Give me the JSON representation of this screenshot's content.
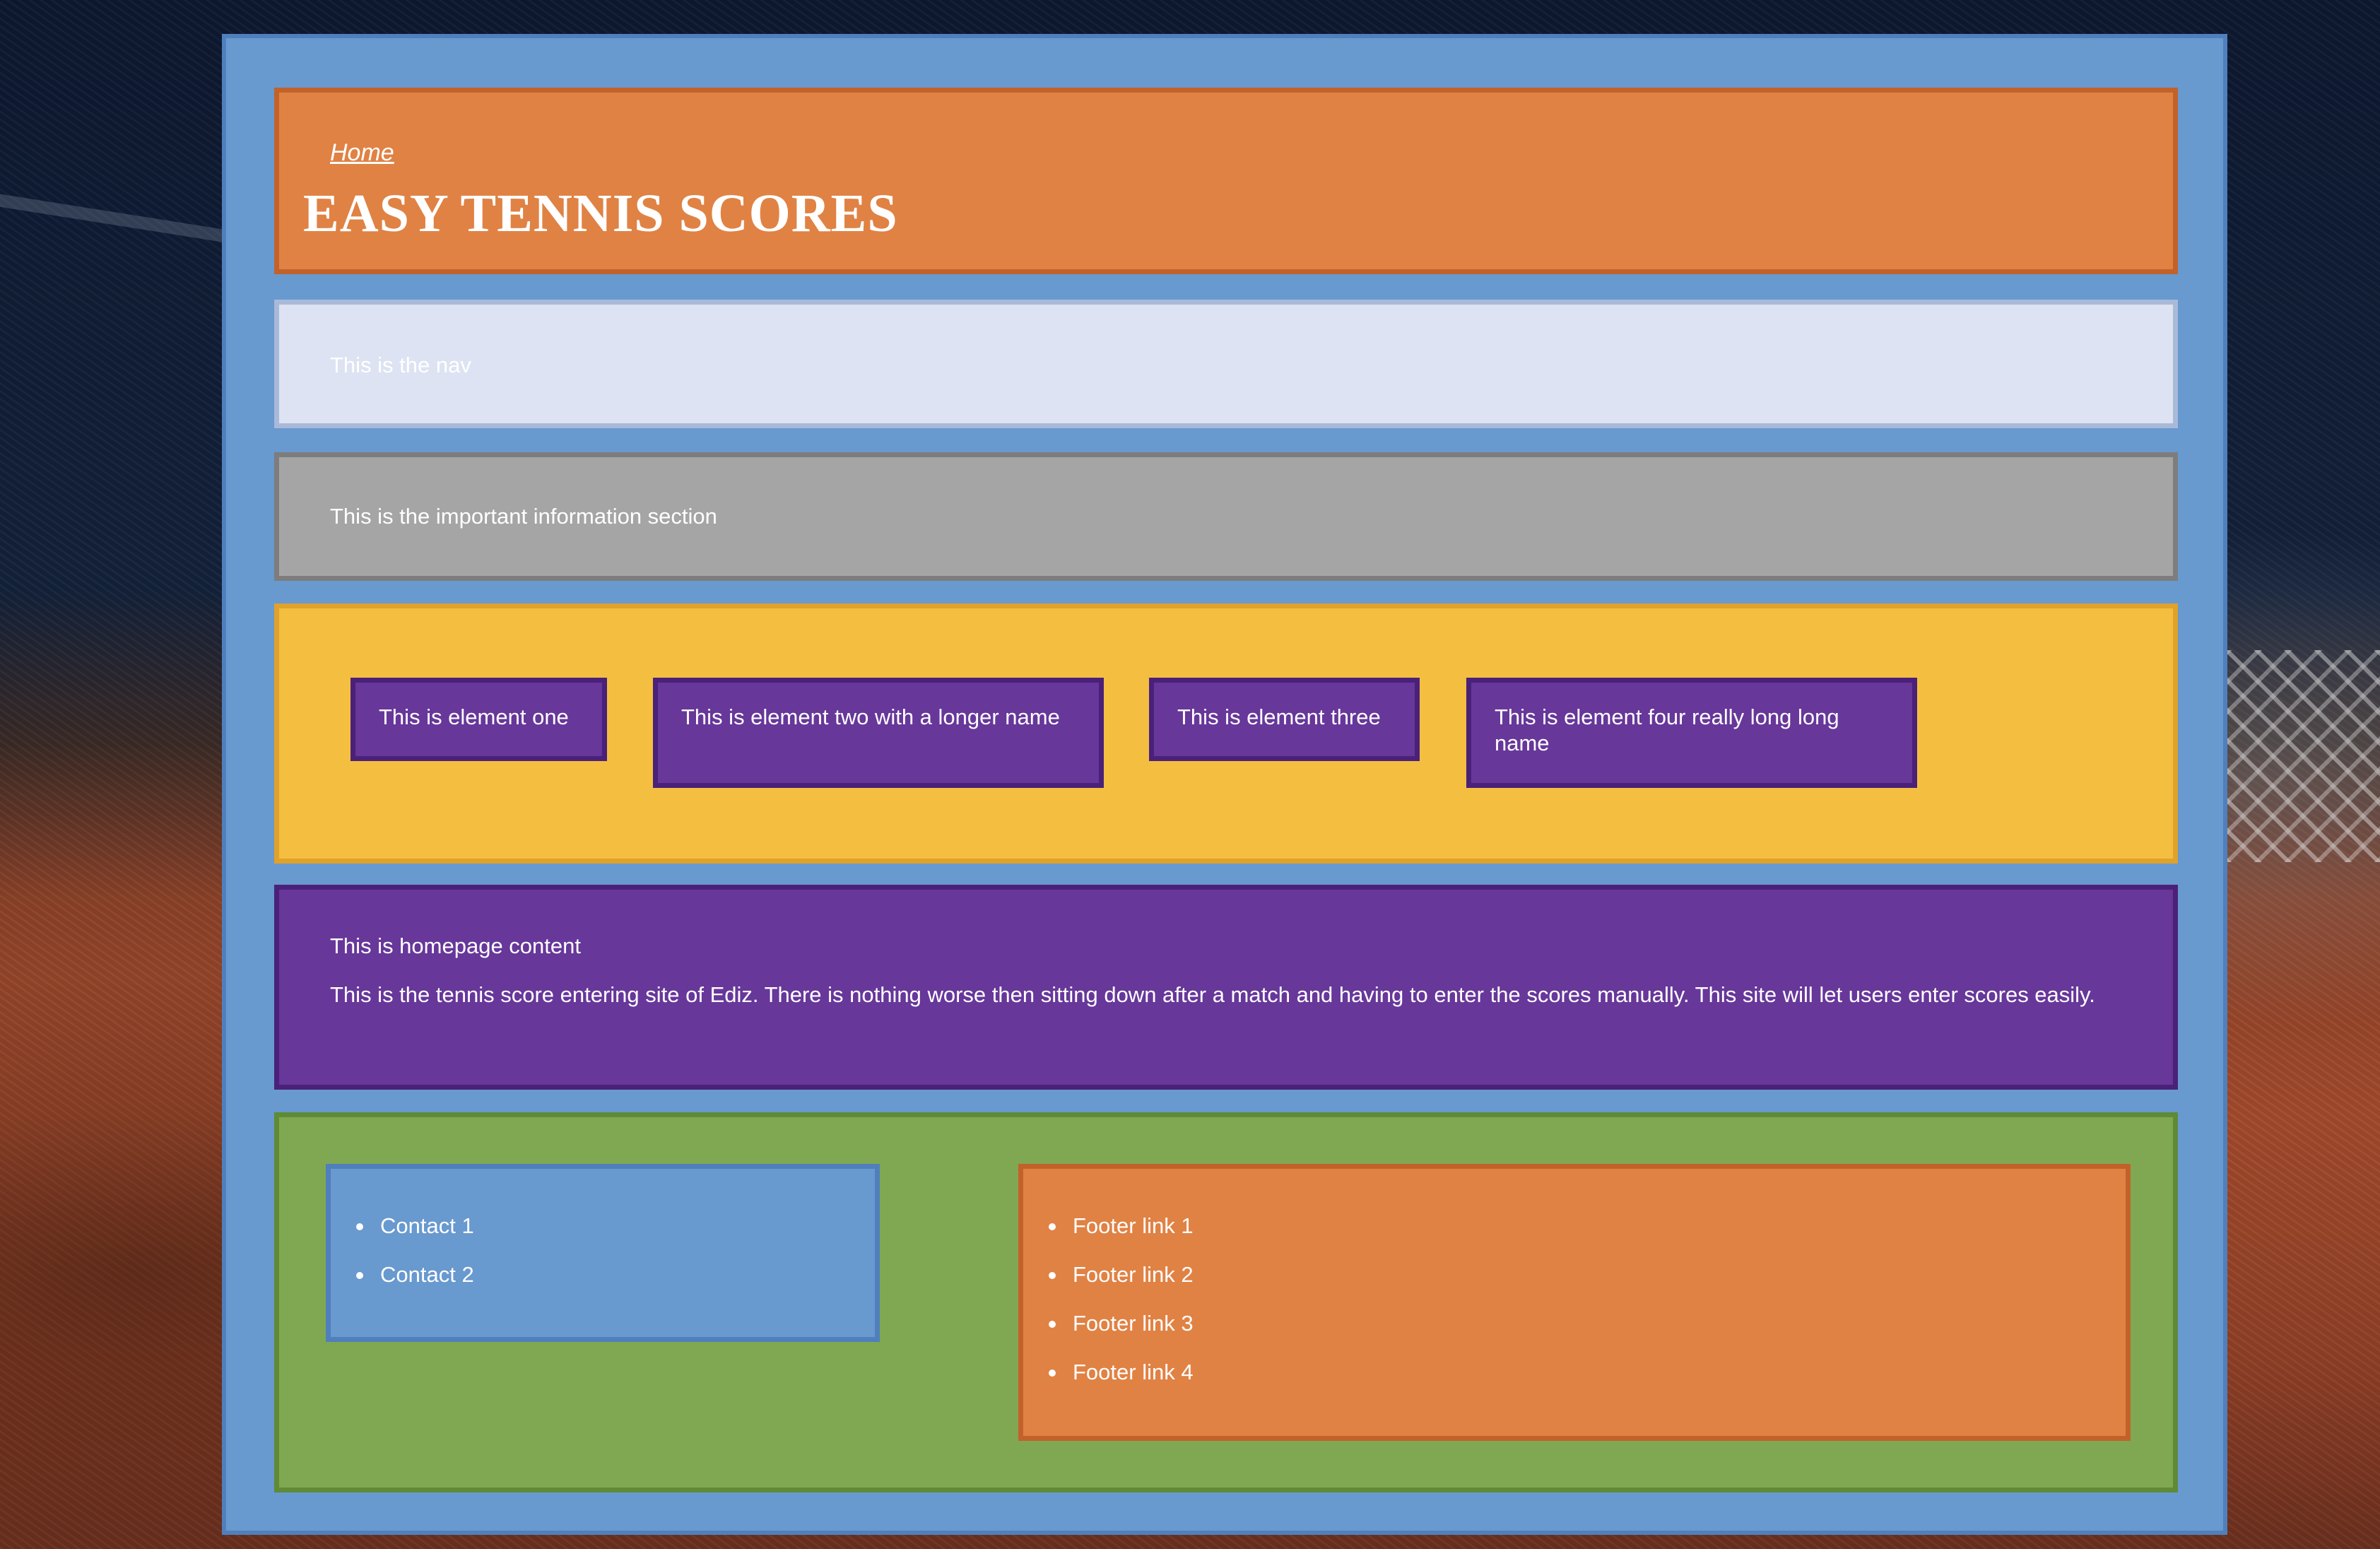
{
  "header": {
    "home_link": "Home",
    "title": "EASY TENNIS SCORES"
  },
  "nav": {
    "text": "This is the nav"
  },
  "info": {
    "text": "This is the important information section"
  },
  "elements": [
    {
      "label": "This is element one"
    },
    {
      "label": "This is element two with a longer name"
    },
    {
      "label": "This is element three"
    },
    {
      "label": "This is element four really long long name"
    }
  ],
  "content": {
    "title": "This is homepage content",
    "body": "This is the tennis score entering site of Ediz. There is nothing worse then sitting down after a match and having to enter the scores manually. This site will let users enter scores easily."
  },
  "footer": {
    "contacts": [
      "Contact 1",
      "Contact 2"
    ],
    "links": [
      "Footer link 1",
      "Footer link 2",
      "Footer link 3",
      "Footer link 4"
    ]
  },
  "colors": {
    "container": "#6899cf",
    "header": "#e08244",
    "nav": "#dde3f2",
    "info": "#a5a5a5",
    "elements_bg": "#f4be41",
    "element_box": "#67379a",
    "content": "#67379a",
    "footer": "#80a853"
  }
}
